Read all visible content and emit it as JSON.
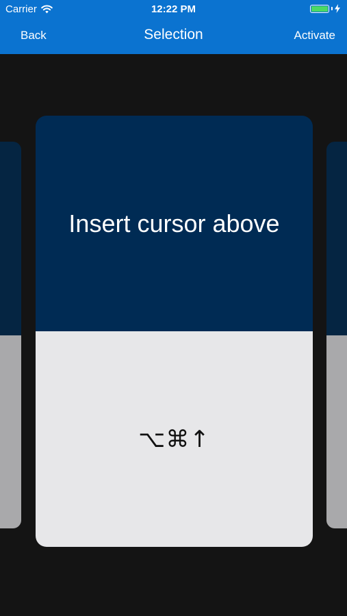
{
  "status_bar": {
    "carrier": "Carrier",
    "time": "12:22 PM",
    "icons": [
      "wifi-icon",
      "battery-icon",
      "charging-bolt-icon"
    ],
    "battery_level": 1.0
  },
  "nav_bar": {
    "back_label": "Back",
    "title": "Selection",
    "activate_label": "Activate"
  },
  "card": {
    "title": "Insert cursor above",
    "shortcut": "⌥⌘↑"
  },
  "colors": {
    "nav_background": "#0b73d0",
    "page_background": "#141414",
    "card_top": "#002b54",
    "card_bottom": "#e7e7e9",
    "battery_fill": "#4cd964"
  }
}
